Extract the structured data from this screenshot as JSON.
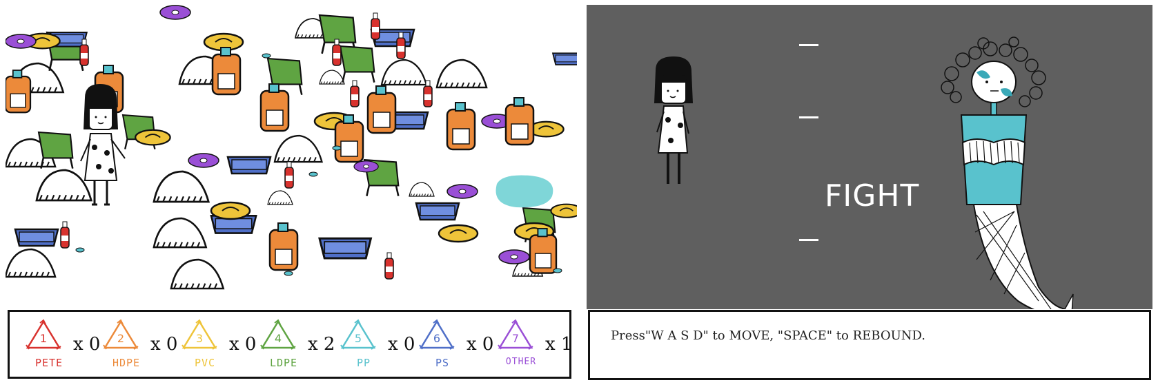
{
  "colors": {
    "pete": "#d8322e",
    "hdpe": "#ec8a3a",
    "pvc": "#eec43a",
    "ldpe": "#5fa442",
    "pp": "#59c2cd",
    "ps": "#4f6fc8",
    "other": "#9a4fd6",
    "fight_bg": "#5f5f5f"
  },
  "inventory": [
    {
      "num": "1",
      "code": "PETE",
      "count": "x 0",
      "color_key": "pete"
    },
    {
      "num": "2",
      "code": "HDPE",
      "count": "x 0",
      "color_key": "hdpe"
    },
    {
      "num": "3",
      "code": "PVC",
      "count": "x 0",
      "color_key": "pvc"
    },
    {
      "num": "4",
      "code": "LDPE",
      "count": "x 2",
      "color_key": "ldpe"
    },
    {
      "num": "5",
      "code": "PP",
      "count": "x 0",
      "color_key": "pp"
    },
    {
      "num": "6",
      "code": "PS",
      "count": "x 0",
      "color_key": "ps"
    },
    {
      "num": "7",
      "code": "OTHER",
      "count": "x 1",
      "color_key": "other"
    }
  ],
  "fight": {
    "title": "FIGHT",
    "instructions": "Press\"W A S D\" to MOVE, \"SPACE\" to REBOUND."
  },
  "icons": [
    "recycle-icon",
    "player-character",
    "mermaid-cup-boss",
    "rock-icon",
    "detergent-bottle-icon",
    "tray-icon",
    "sandal-icon",
    "green-chair-icon",
    "purple-disc-icon",
    "red-bottle-icon"
  ]
}
